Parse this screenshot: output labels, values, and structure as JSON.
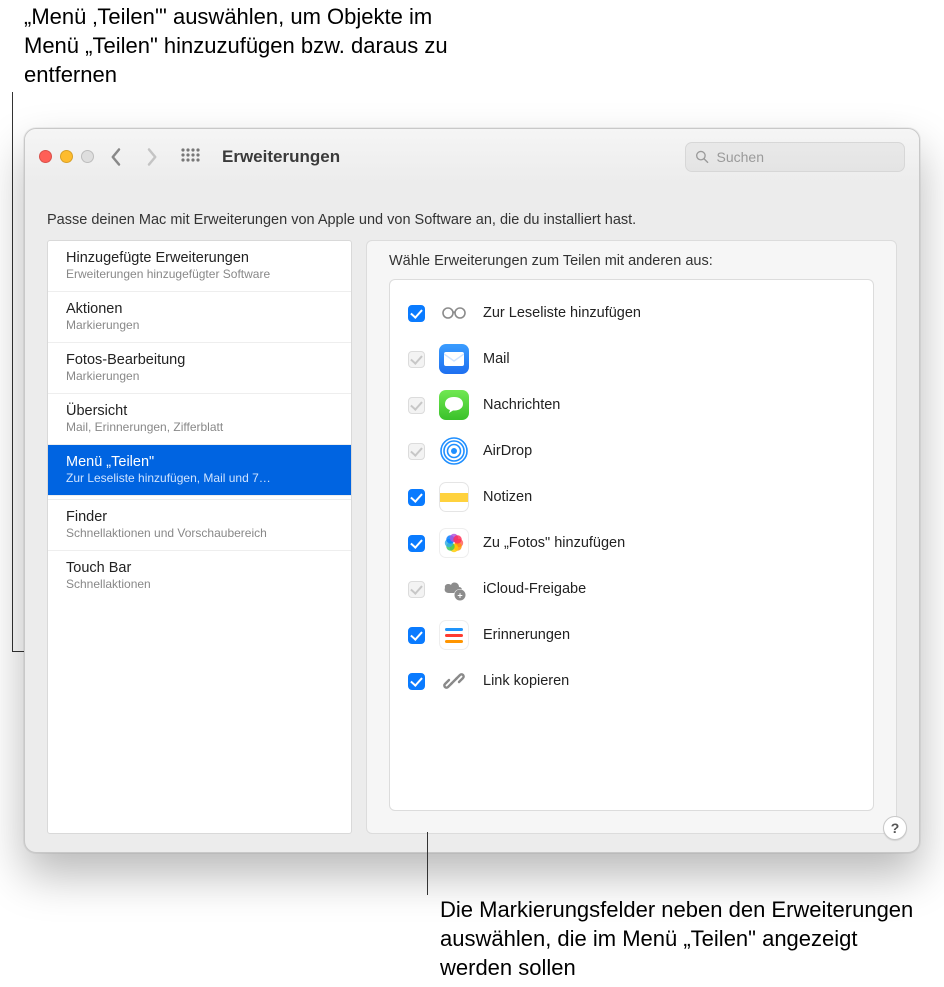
{
  "callouts": {
    "top": "„Menü ‚Teilen'\" auswählen, um Objekte im Menü „Teilen\" hinzuzufügen bzw. daraus zu entfernen",
    "bottom": "Die Markierungsfelder neben den Erweiterungen auswählen, die im Menü „Teilen\" angezeigt werden sollen"
  },
  "window": {
    "title": "Erweiterungen",
    "search_placeholder": "Suchen",
    "description": "Passe deinen Mac mit Erweiterungen von Apple und von Software an, die du installiert hast."
  },
  "sidebar": {
    "items": [
      {
        "label": "Hinzugefügte Erweiterungen",
        "sub": "Erweiterungen hinzugefügter Software",
        "selected": false
      },
      {
        "label": "Aktionen",
        "sub": "Markierungen",
        "selected": false
      },
      {
        "label": "Fotos-Bearbeitung",
        "sub": "Markierungen",
        "selected": false
      },
      {
        "label": "Übersicht",
        "sub": "Mail, Erinnerungen, Zifferblatt",
        "selected": false
      },
      {
        "label": "Menü „Teilen\"",
        "sub": "Zur Leseliste hinzufügen, Mail und 7…",
        "selected": true
      },
      {
        "label": "Finder",
        "sub": "Schnellaktionen und Vorschaubereich",
        "selected": false
      },
      {
        "label": "Touch Bar",
        "sub": "Schnellaktionen",
        "selected": false
      }
    ]
  },
  "detail": {
    "heading": "Wähle Erweiterungen zum Teilen mit anderen aus:",
    "items": [
      {
        "label": "Zur Leseliste hinzufügen",
        "state": "on",
        "icon": "glasses"
      },
      {
        "label": "Mail",
        "state": "dis",
        "icon": "mail"
      },
      {
        "label": "Nachrichten",
        "state": "dis",
        "icon": "messages"
      },
      {
        "label": "AirDrop",
        "state": "dis",
        "icon": "airdrop"
      },
      {
        "label": "Notizen",
        "state": "on",
        "icon": "notes"
      },
      {
        "label": "Zu „Fotos\" hinzufügen",
        "state": "on",
        "icon": "photos"
      },
      {
        "label": "iCloud-Freigabe",
        "state": "dis",
        "icon": "icloud"
      },
      {
        "label": "Erinnerungen",
        "state": "on",
        "icon": "reminders"
      },
      {
        "label": "Link kopieren",
        "state": "on",
        "icon": "link"
      }
    ]
  },
  "help_label": "?"
}
